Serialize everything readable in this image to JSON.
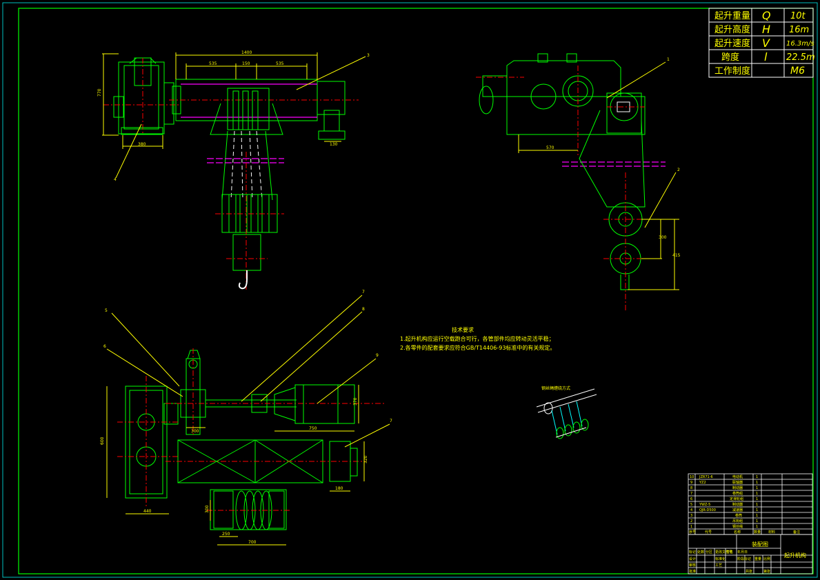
{
  "spec_table": {
    "rows": [
      {
        "label": "起升重量",
        "symbol": "Q",
        "value": "10t"
      },
      {
        "label": "起升高度",
        "symbol": "H",
        "value": "16m"
      },
      {
        "label": "起升速度",
        "symbol": "V",
        "value": "16.3m/s"
      },
      {
        "label": "跨度",
        "symbol": "l",
        "value": "22.5m"
      },
      {
        "label": "工作制度",
        "symbol": "",
        "value": "M6"
      }
    ]
  },
  "notes": {
    "title": "技术要求",
    "lines": [
      "1.起升机构应运行空载跑合可行，各管部件均应转动灵活平稳；",
      "2.各零件的配套要求应符合GB/T14406-93标准中的有关规定。"
    ]
  },
  "rope_label": "钢丝绳缠绕方式",
  "callouts": [
    "1",
    "2",
    "3",
    "4",
    "5",
    "6",
    "7",
    "8",
    "9",
    "7"
  ],
  "dims": {
    "top_span": "1400",
    "top_left": "535",
    "top_mid": "150",
    "top_right": "535",
    "gear_h": "770",
    "gear_w": "380",
    "base_w": "130",
    "right_w": "570",
    "right_h1": "300",
    "right_h2": "415",
    "bl_h": "600",
    "bl_w": "440",
    "motor_h": "370",
    "motor_w": "750",
    "brake_h": "250",
    "brake_w": "300",
    "drum_h": "320",
    "drum_w": "370",
    "pulley_h": "300",
    "pulley_a": "250",
    "pulley_b": "700",
    "drum_gap": "180"
  },
  "parts_list": {
    "rows": [
      {
        "no": "10",
        "code": "JZR71-6",
        "name": "电动机",
        "qty": "1"
      },
      {
        "no": "9",
        "code": "YZ2",
        "name": "联轴器",
        "qty": "1"
      },
      {
        "no": "8",
        "code": "",
        "name": "制动器",
        "qty": "1"
      },
      {
        "no": "7",
        "code": "",
        "name": "卷筒组",
        "qty": "1"
      },
      {
        "no": "6",
        "code": "",
        "name": "定滑轮组",
        "qty": "1"
      },
      {
        "no": "5",
        "code": "YWZ-5",
        "name": "制动器",
        "qty": "1"
      },
      {
        "no": "4",
        "code": "QJR-D500",
        "name": "减速器",
        "qty": "1"
      },
      {
        "no": "3",
        "code": "",
        "name": "卷筒",
        "qty": "1"
      },
      {
        "no": "2",
        "code": "",
        "name": "吊钩组",
        "qty": "1"
      },
      {
        "no": "1",
        "code": "",
        "name": "钢丝绳",
        "qty": "1"
      }
    ],
    "header": [
      "序号",
      "代号",
      "名称",
      "数量",
      "材料",
      "备注"
    ]
  },
  "title_block": {
    "drawing_name": "装配图",
    "mechanism": "起升机构",
    "fields": [
      "标记",
      "处数",
      "分区",
      "更改文件号",
      "签名",
      "年月日",
      "设计",
      "标准化",
      "审核",
      "工艺",
      "批准",
      "阶段标记",
      "重量",
      "比例",
      "共张",
      "第张"
    ]
  },
  "colors": {
    "background": "#000000",
    "frame": "#00ff00",
    "outline": "#00ff00",
    "text": "#ffff00",
    "center": "#ff0000",
    "dim": "#ffff00",
    "phantom": "#ff00ff",
    "hidden": "#00ffff",
    "white": "#ffffff"
  }
}
